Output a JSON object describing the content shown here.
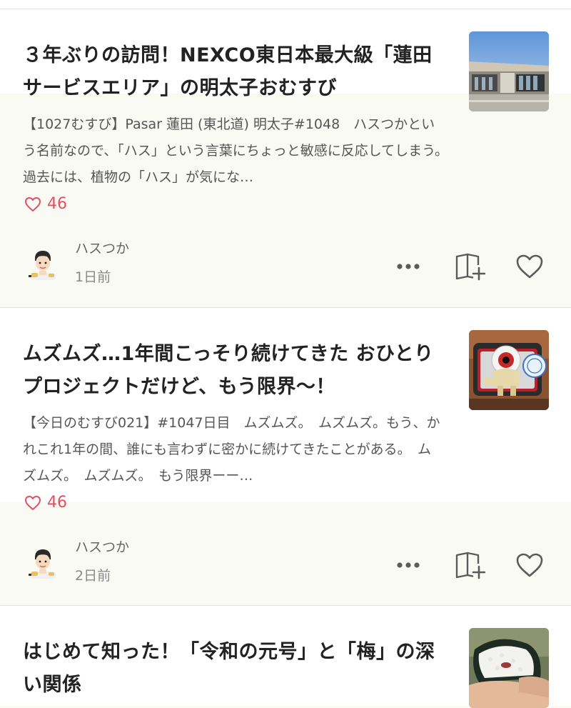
{
  "colors": {
    "accent_like": "#e0505f",
    "text_primary": "#222222",
    "text_secondary": "#555555",
    "icon": "#5b5b5b",
    "lower_panel_bg": "#fafaf5"
  },
  "icons": {
    "like": "heart-outline",
    "more": "more-horizontal",
    "magazine": "book-plus",
    "favorite": "heart-outline"
  },
  "articles": [
    {
      "title": "３年ぶりの訪問！NEXCO東日本最大級「蓮田サービスエリア」の明太子おむすび",
      "excerpt": "【1027むすび】Pasar 蓮田 (東北道) 明太子#1048　ハスつかという名前なので、「ハス」という言葉にちょっと敏感に反応してしまう。　過去には、植物の「ハス」が気にな…",
      "likes": "46",
      "author": "ハスつか",
      "time": "1日前"
    },
    {
      "title": "ムズムズ…1年間こっそり続けてきた おひとりプロジェクトだけど、もう限界〜！",
      "excerpt": "【今日のむすび021】#1047日目　ムズムズ。　ムズムズ。もう、かれこれ1年の間、誰にも言わずに密かに続けてきたことがある。　ムズムズ。　ムズムズ。　もう限界ーー…",
      "likes": "46",
      "author": "ハスつか",
      "time": "2日前"
    },
    {
      "title": "はじめて知った！「令和の元号」と「梅」の深い関係"
    }
  ]
}
